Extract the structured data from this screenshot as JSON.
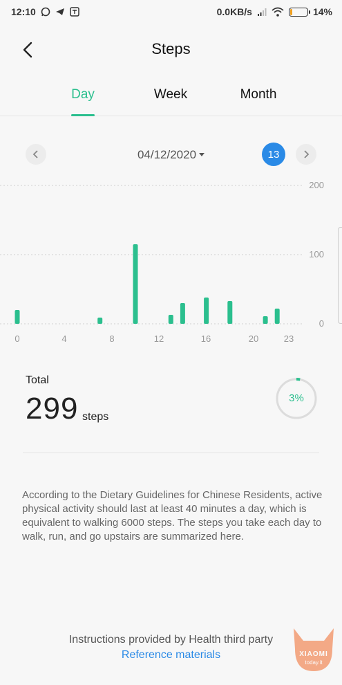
{
  "status_bar": {
    "time": "12:10",
    "net_speed": "0.0KB/s",
    "battery_percent": "14%",
    "battery_level": 0.14
  },
  "header": {
    "title": "Steps"
  },
  "tabs": [
    {
      "label": "Day",
      "active": true
    },
    {
      "label": "Week",
      "active": false
    },
    {
      "label": "Month",
      "active": false
    }
  ],
  "date_nav": {
    "date": "04/12/2020",
    "today_badge": "13"
  },
  "chart_data": {
    "type": "bar",
    "y_ticks": [
      "200",
      "100",
      "0"
    ],
    "ylim": [
      0,
      200
    ],
    "x_ticks": [
      "0",
      "4",
      "8",
      "12",
      "16",
      "20",
      "23"
    ],
    "hours": [
      0,
      7,
      10,
      13,
      14,
      16,
      18,
      21,
      22
    ],
    "values": [
      20,
      9,
      115,
      13,
      30,
      38,
      33,
      11,
      22
    ],
    "bar_color": "#2bbf8e"
  },
  "summary": {
    "total_label": "Total",
    "total_value": "299",
    "unit": "steps",
    "goal_percent": "3%",
    "goal_fraction": 0.03
  },
  "description": "According to the Dietary Guidelines for Chinese Residents, active physical activity should last at least 40 minutes a day, which is equivalent to walking 6000 steps. The steps you take each day to walk, run, and go upstairs are summarized here.",
  "footer": {
    "note": "Instructions provided by Health third party",
    "link": "Reference materials"
  },
  "watermark": {
    "text": "XIAOMI",
    "sub": "today.it"
  },
  "colors": {
    "accent": "#2bbf8e",
    "link": "#2a8ae6"
  }
}
